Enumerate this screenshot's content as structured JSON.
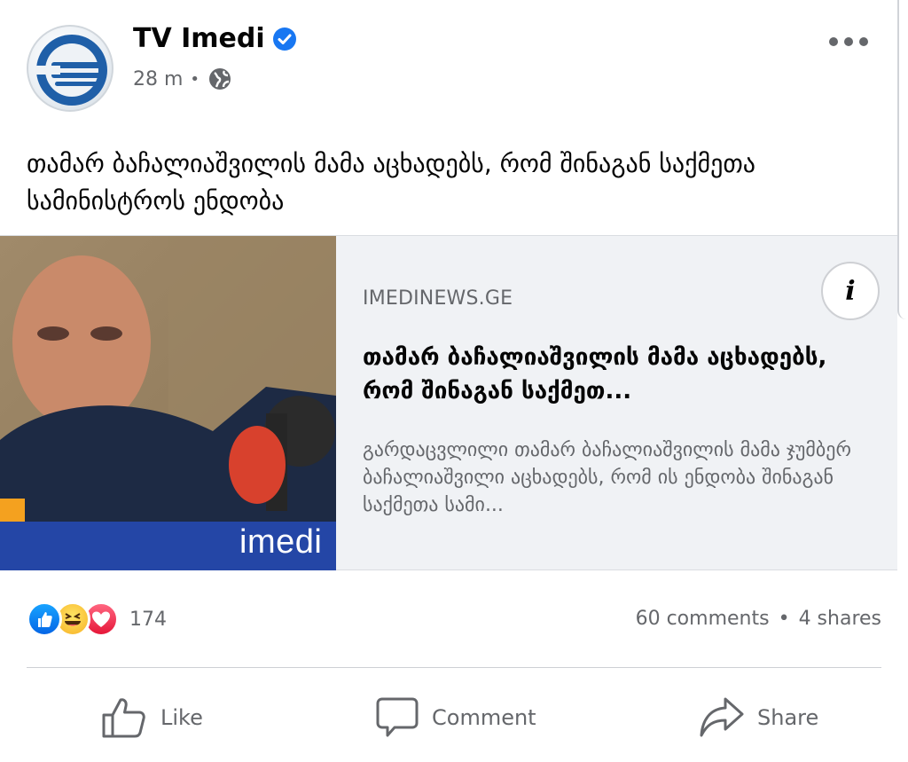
{
  "post": {
    "page_name": "TV Imedi",
    "time": "28 m",
    "separator": "•",
    "text": "თამარ ბაჩალიაშვილის მამა აცხადებს, რომ შინაგან საქმეთა სამინისტროს ენდობა"
  },
  "icons": {
    "avatar": "tv-imedi-logo",
    "verified": "verified-badge-icon",
    "privacy": "globe-icon",
    "more": "more-options-icon",
    "info": "info-icon"
  },
  "link_card": {
    "domain": "IMEDINEWS.GE",
    "title": "თამარ ბაჩალიაშვილის მამა აცხადებს, რომ შინაგან საქმეთ...",
    "description": "გარდაცვლილი თამარ ბაჩალიაშვილის მამა ჯუმბერ ბაჩალიაშვილი აცხადებს, რომ ის ენდობა შინაგან საქმეთა სამი...",
    "thumbnail_watermark": "imedi",
    "info_label": "i"
  },
  "engagement": {
    "reaction_count": "174",
    "comments": "60 comments",
    "separator": "•",
    "shares": "4 shares",
    "reactions": [
      "like",
      "haha",
      "love"
    ]
  },
  "actions": {
    "like": "Like",
    "comment": "Comment",
    "share": "Share"
  },
  "colors": {
    "verified": "#1877f2",
    "secondary_text": "#65676b",
    "card_bg": "#f0f2f5",
    "imedi_blue": "#2446a6"
  }
}
